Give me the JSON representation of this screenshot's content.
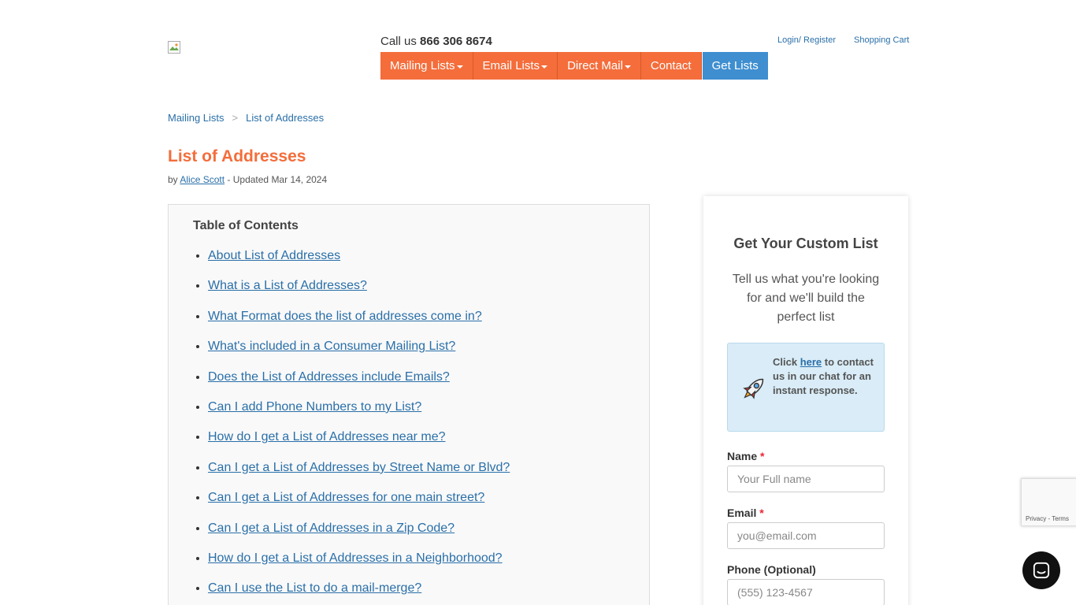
{
  "header": {
    "call_prefix": "Call us",
    "call_number": "866 306 8674",
    "login_link": "Login/ Register",
    "cart_link": "Shopping Cart"
  },
  "nav": {
    "items": [
      {
        "label": "Mailing Lists",
        "dropdown": true
      },
      {
        "label": "Email Lists",
        "dropdown": true
      },
      {
        "label": "Direct Mail",
        "dropdown": true
      },
      {
        "label": "Contact",
        "dropdown": false
      },
      {
        "label": "Get Lists",
        "dropdown": false
      }
    ],
    "colors": {
      "primary": "#f46d3b",
      "accent": "#3e8ed0"
    }
  },
  "breadcrumb": {
    "items": [
      "Mailing Lists",
      "List of Addresses"
    ],
    "separator": ">"
  },
  "article": {
    "title": "List of Addresses",
    "by": "by",
    "author": "Alice Scott",
    "updated": "- Updated Mar 14, 2024"
  },
  "toc": {
    "title": "Table of Contents",
    "items": [
      "About List of Addresses",
      "What is a List of Addresses?",
      "What Format does the list of addresses come in?",
      "What's included in a Consumer Mailing List?",
      "Does the List of Addresses include Emails?",
      "Can I add Phone Numbers to my List?",
      "How do I get a List of Addresses near me?",
      "Can I get a List of Addresses by Street Name or Blvd?",
      "Can I get a List of Addresses for one main street?",
      "Can I get a List of Addresses in a Zip Code?",
      "How do I get a List of Addresses in a Neighborhood?",
      "Can I use the List to do a mail-merge?"
    ]
  },
  "sidebar": {
    "title": "Get Your Custom List",
    "subtitle": "Tell us what you're looking for and we'll build the perfect list",
    "chat": {
      "prefix": "Click",
      "link": "here",
      "suffix": "to contact us in our chat for an instant response.",
      "icon": "rocket-icon"
    },
    "form": {
      "name_label": "Name",
      "name_placeholder": "Your Full name",
      "email_label": "Email",
      "email_placeholder": "you@email.com",
      "phone_label": "Phone (Optional)",
      "phone_placeholder": "(555) 123-4567",
      "required_mark": "*"
    }
  },
  "recaptcha": {
    "text": "Privacy - Terms"
  }
}
